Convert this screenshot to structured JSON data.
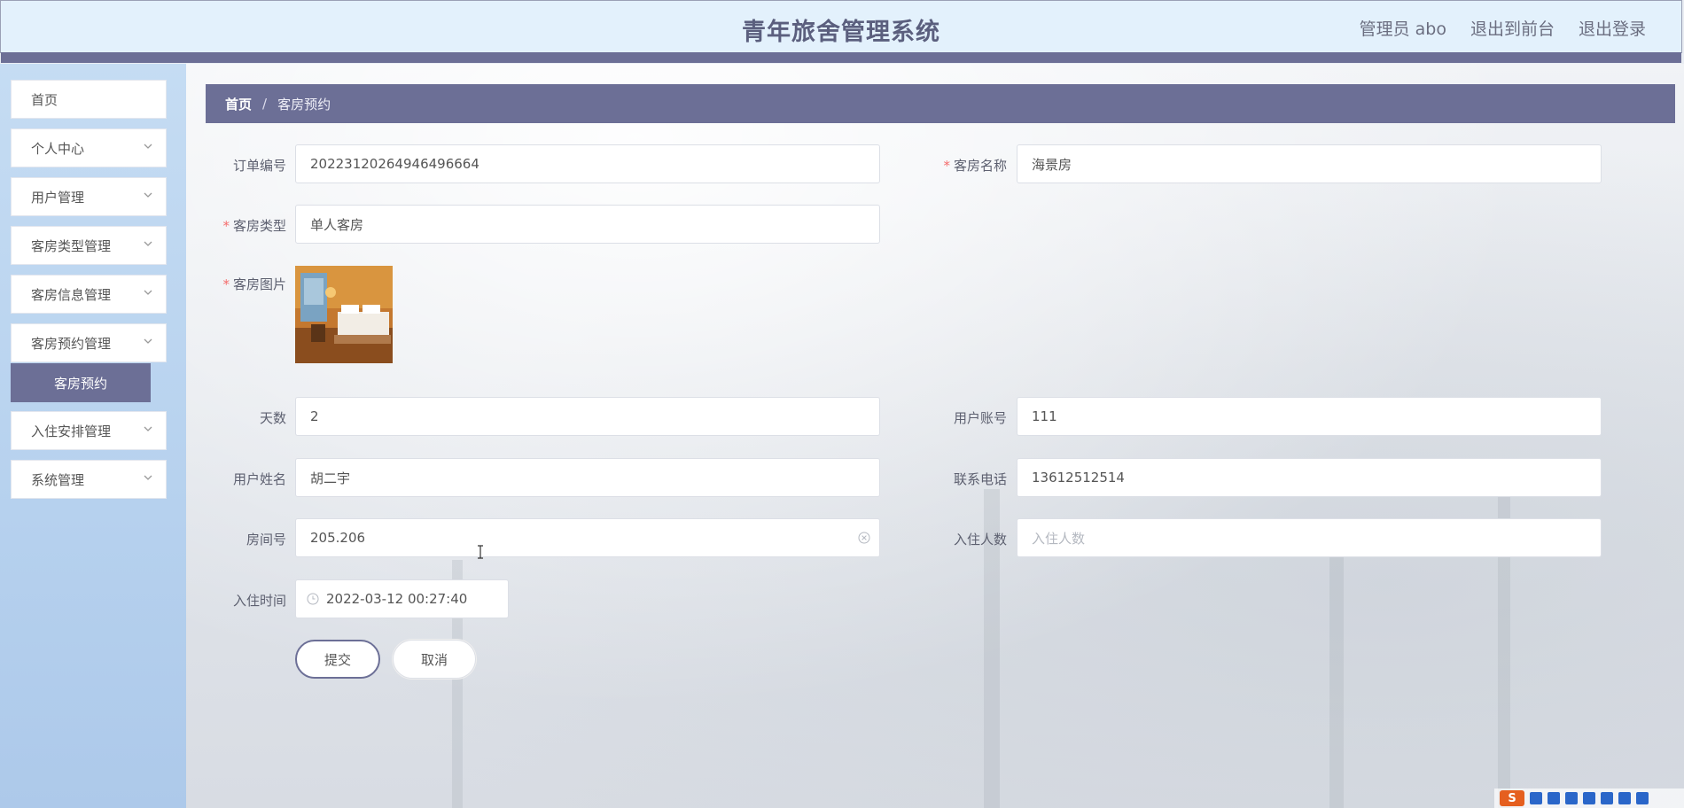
{
  "header": {
    "title": "青年旅舍管理系统",
    "user": "管理员 abo",
    "back_to_front": "退出到前台",
    "logout": "退出登录"
  },
  "sidebar": {
    "items": [
      {
        "label": "首页"
      },
      {
        "label": "个人中心"
      },
      {
        "label": "用户管理"
      },
      {
        "label": "客房类型管理"
      },
      {
        "label": "客房信息管理"
      },
      {
        "label": "客房预约管理"
      },
      {
        "label": "入住安排管理"
      },
      {
        "label": "系统管理"
      }
    ],
    "active_sub": "客房预约"
  },
  "breadcrumb": {
    "home": "首页",
    "separator": "/",
    "current": "客房预约"
  },
  "form": {
    "order_no": {
      "label": "订单编号",
      "value": "20223120264946496664"
    },
    "room_name": {
      "label": "客房名称",
      "value": "海景房"
    },
    "room_type": {
      "label": "客房类型",
      "value": "单人客房"
    },
    "room_image": {
      "label": "客房图片"
    },
    "days": {
      "label": "天数",
      "value": "2"
    },
    "user_account": {
      "label": "用户账号",
      "value": "111"
    },
    "user_name": {
      "label": "用户姓名",
      "value": "胡二宇"
    },
    "phone": {
      "label": "联系电话",
      "value": "13612512514"
    },
    "room_no": {
      "label": "房间号",
      "value": "205.206"
    },
    "guests": {
      "label": "入住人数",
      "placeholder": "入住人数"
    },
    "checkin_time": {
      "label": "入住时间",
      "value": "2022-03-12 00:27:40"
    },
    "submit": "提交",
    "cancel": "取消"
  },
  "tray": {
    "logo": "S"
  },
  "colors": {
    "accent": "#6c6f96",
    "required": "#f56c6c",
    "header_bg": "#e3f1fc"
  }
}
